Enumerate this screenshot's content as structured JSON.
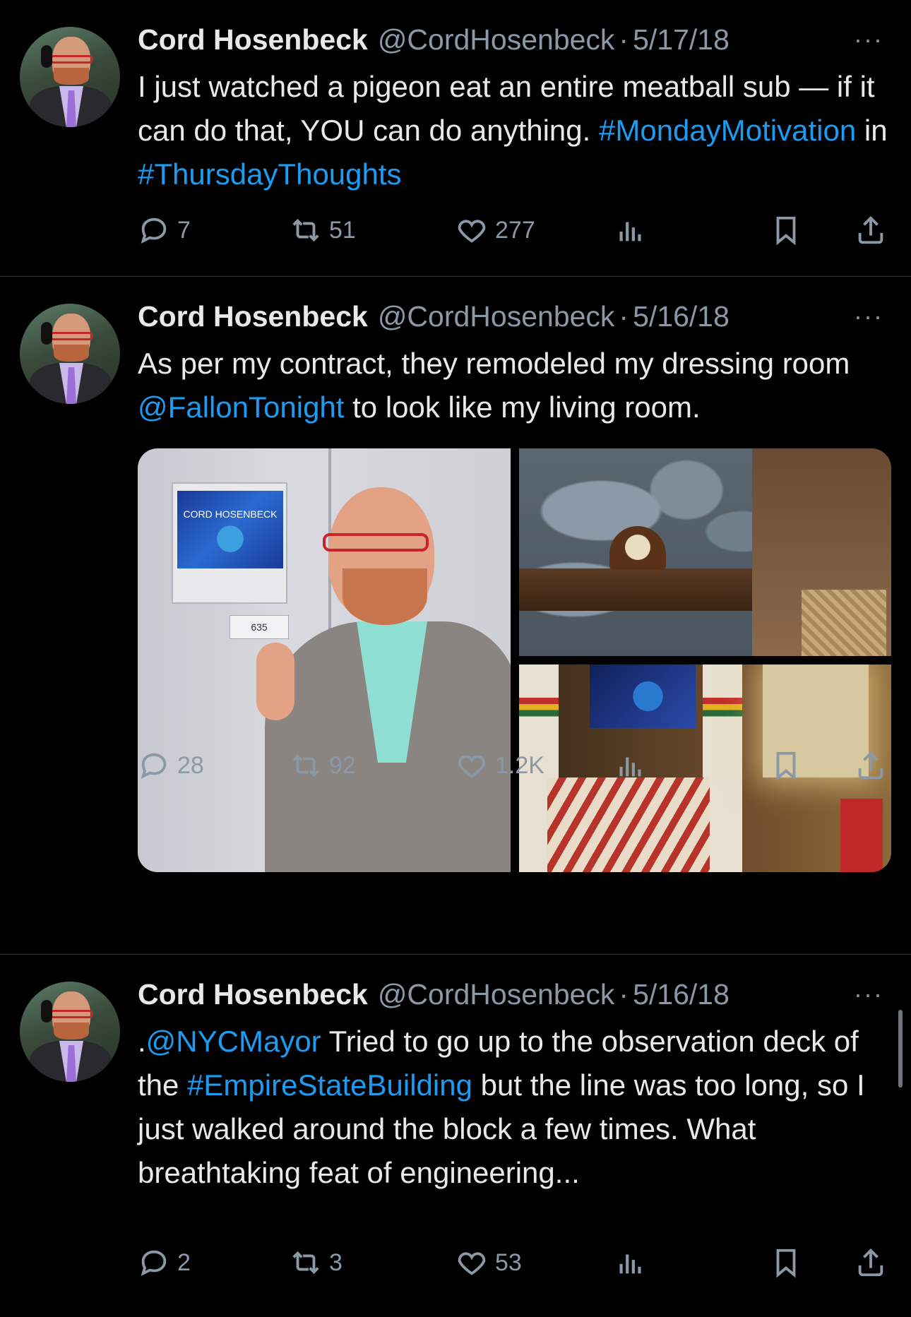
{
  "tweets": [
    {
      "name": "Cord Hosenbeck",
      "handle": "@CordHosenbeck",
      "sep": "·",
      "date": "5/17/18",
      "more": "···",
      "segments": [
        {
          "t": "I just watched a pigeon eat an entire meatball sub — if it can do that, YOU can do anything. ",
          "link": false
        },
        {
          "t": "#MondayMotivation",
          "link": true
        },
        {
          "t": " in ",
          "link": false
        },
        {
          "t": "#ThursdayThoughts",
          "link": true
        }
      ],
      "replies": "7",
      "retweets": "51",
      "likes": "277",
      "views": ""
    },
    {
      "name": "Cord Hosenbeck",
      "handle": "@CordHosenbeck",
      "sep": "·",
      "date": "5/16/18",
      "more": "···",
      "segments": [
        {
          "t": "As per my contract, they remodeled my dressing room ",
          "link": false
        },
        {
          "t": "@FallonTonight",
          "link": true
        },
        {
          "t": " to look like my living room.",
          "link": false
        }
      ],
      "media": {
        "door_label": "CORD HOSENBECK",
        "room_number": "635"
      },
      "replies": "28",
      "retweets": "92",
      "likes": "1.2K",
      "views": ""
    },
    {
      "name": "Cord Hosenbeck",
      "handle": "@CordHosenbeck",
      "sep": "·",
      "date": "5/16/18",
      "more": "···",
      "segments": [
        {
          "t": ".",
          "link": false
        },
        {
          "t": "@NYCMayor",
          "link": true
        },
        {
          "t": " Tried to go up to the observation deck of the ",
          "link": false
        },
        {
          "t": "#EmpireStateBuilding",
          "link": true
        },
        {
          "t": " but the line was too long, so I just walked around the block a few times. What breathtaking feat of engineering...",
          "link": false
        }
      ],
      "replies": "2",
      "retweets": "3",
      "likes": "53",
      "views": ""
    }
  ],
  "icons": {
    "reply": "reply-icon",
    "retweet": "retweet-icon",
    "like": "heart-icon",
    "views": "views-icon",
    "bookmark": "bookmark-icon",
    "share": "share-icon"
  },
  "colors": {
    "background": "#000000",
    "text": "#e7e9ea",
    "secondary": "#8b98a5",
    "link": "#1d9bf0",
    "divider": "#2f3336"
  }
}
